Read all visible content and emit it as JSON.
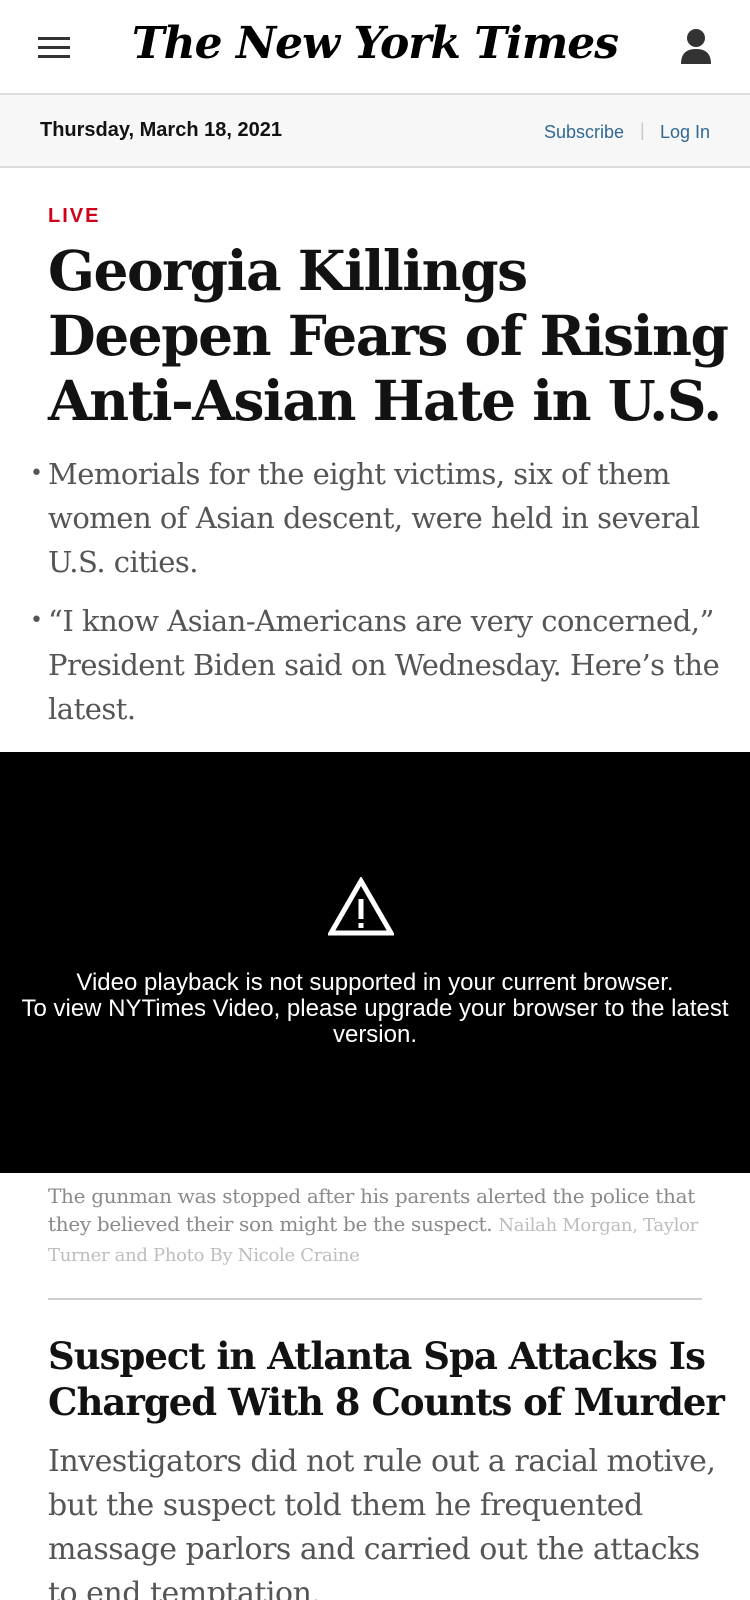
{
  "header": {
    "logo_text": "The New York Times",
    "menu_icon": "hamburger-menu-icon",
    "account_icon": "user-account-icon"
  },
  "datebar": {
    "date": "Thursday, March 18, 2021",
    "subscribe_label": "Subscribe",
    "separator": "|",
    "login_label": "Log In"
  },
  "article": {
    "kicker": "LIVE",
    "headline": "Georgia Killings Deepen Fears of Rising Anti-Asian Hate in U.S.",
    "bullets": [
      "Memorials for the eight victims, six of them women of Asian descent, were held in several U.S. cities.",
      "“I know Asian-Americans are very concerned,” President Biden said on Wednesday. Here’s the latest."
    ]
  },
  "video": {
    "icon": "warning-icon",
    "message_line1": "Video playback is not supported in your current browser.",
    "message_line2": "To view NYTimes Video, please upgrade your browser to the latest version."
  },
  "caption": {
    "text": "The gunman was stopped after his parents alerted the police that they believed their son might be the suspect.",
    "credit": "Nailah Morgan, Taylor Turner and Photo By Nicole Craine"
  },
  "story": {
    "title": "Suspect in Atlanta Spa Attacks Is Charged With 8 Counts of Murder",
    "summary": "Investigators did not rule out a racial motive, but the suspect told them he frequented massage parlors and carried out the attacks to end temptation."
  },
  "colors": {
    "live_red": "#d0021b",
    "link_blue": "#326891",
    "datebar_bg": "#f7f7f7"
  }
}
